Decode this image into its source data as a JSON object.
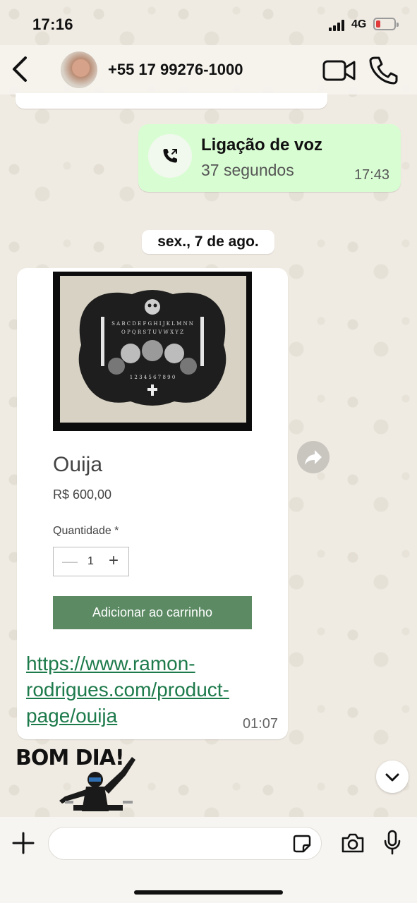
{
  "status_bar": {
    "time": "17:16",
    "network": "4G",
    "battery_level": 0.15,
    "battery_color": "#e03a3a"
  },
  "header": {
    "contact_name": "+55 17 99276-1000"
  },
  "call_message": {
    "title": "Ligação de voz",
    "duration": "37 segundos",
    "time": "17:43",
    "bubble_color": "#d9fdd3"
  },
  "date_separator": "sex., 7 de ago.",
  "product_message": {
    "product_name": "Ouija",
    "price": "R$ 600,00",
    "quantity_label": "Quantidade *",
    "quantity_value": "1",
    "minus_label": "—",
    "plus_label": "+",
    "add_to_cart_label": "Adicionar ao carrinho",
    "add_to_cart_color": "#5b8a63",
    "board_text_top": "S  A B C D E F G H I J K L M N  N",
    "board_text_mid": "O P Q R S T U V W X Y Z",
    "board_digits": "1 2 3 4 5 6 7 8 9 0",
    "link_text": "https://www.ramon-rodrigues.com/product-page/ouija",
    "link_color": "#1d7a4b",
    "time": "01:07"
  },
  "sticker": {
    "text": "BOM DIA!"
  },
  "composer": {
    "placeholder": ""
  }
}
